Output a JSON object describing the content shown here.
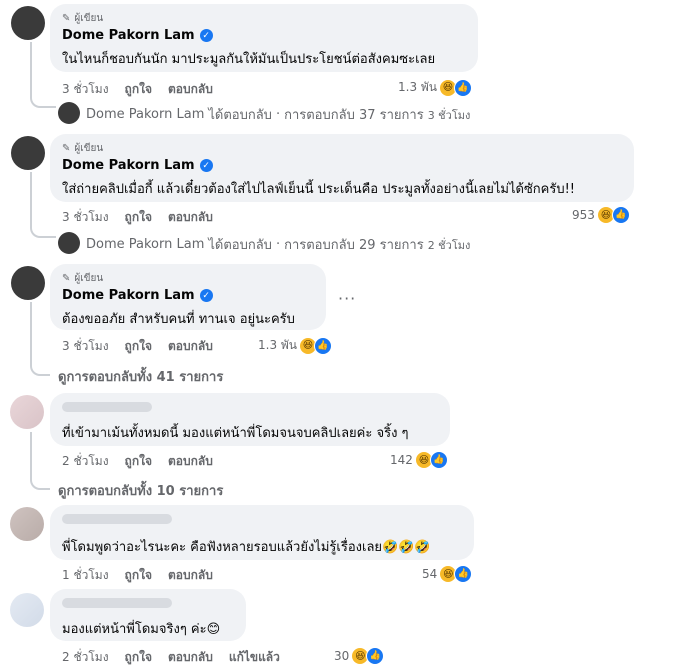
{
  "comments": [
    {
      "author_tag": "ผู้เขียน",
      "author": "Dome Pakorn Lam",
      "text": "ในไหนก็ชอบกันนัก มาประมูลกันให้มันเป็นประโยชน์ต่อสังคมซะเลย",
      "time": "3 ชั่วโมง",
      "like": "ถูกใจ",
      "reply": "ตอบกลับ",
      "reaction_count": "1.3 พัน",
      "reply_summary": {
        "name": "Dome Pakorn Lam",
        "verb": "ได้ตอบกลับ",
        "sep": "·",
        "count_text": "การตอบกลับ 37 รายการ",
        "time": "3 ชั่วโมง"
      }
    },
    {
      "author_tag": "ผู้เขียน",
      "author": "Dome Pakorn Lam",
      "text": "ใส่ถ่ายคลิปเมื่อกี้ แล้วเดี๋ยวต้องใส่ไปไลฟ์เย็นนี้ ประเด็นคือ ประมูลทั้งอย่างนี้เลยไม่ได้ซักครับ!!",
      "time": "3 ชั่วโมง",
      "like": "ถูกใจ",
      "reply": "ตอบกลับ",
      "reaction_count": "953",
      "reply_summary": {
        "name": "Dome Pakorn Lam",
        "verb": "ได้ตอบกลับ",
        "sep": "·",
        "count_text": "การตอบกลับ 29 รายการ",
        "time": "2 ชั่วโมง"
      }
    },
    {
      "author_tag": "ผู้เขียน",
      "author": "Dome Pakorn Lam",
      "text": "ต้องขออภัย สำหรับคนที่ ทานเจ อยู่นะครับ",
      "time": "3 ชั่วโมง",
      "like": "ถูกใจ",
      "reply": "ตอบกลับ",
      "reaction_count": "1.3 พัน",
      "more_dots": "···"
    }
  ],
  "view_all_replies_1": "ดูการตอบกลับทั้ง 41 รายการ",
  "replies": [
    {
      "text": "ที่เข้ามาเม้นทั้งหมดนี้ มองแต่หน้าพี่โดมจนจบคลิปเลยค่ะ จริ้ง ๆ",
      "time": "2 ชั่วโมง",
      "like": "ถูกใจ",
      "reply": "ตอบกลับ",
      "reaction_count": "142"
    },
    {
      "text": "พี่โดมพูดว่าอะไรนะคะ คือฟังหลายรอบแล้วยังไม่รู้เรื่องเลย🤣🤣🤣",
      "time": "1 ชั่วโมง",
      "like": "ถูกใจ",
      "reply": "ตอบกลับ",
      "reaction_count": "54"
    },
    {
      "text": "มองแต่หน้าพี่โดมจริงๆ ค่ะ😊",
      "time": "2 ชั่วโมง",
      "like": "ถูกใจ",
      "reply": "ตอบกลับ",
      "edited": "แก้ไขแล้ว",
      "reaction_count": "30"
    }
  ],
  "view_all_replies_2": "ดูการตอบกลับทั้ง 10 รายการ",
  "icons": {
    "author_tag": "pencil-icon",
    "verified": "verified-badge-icon",
    "haha": "haha-reaction-icon",
    "like": "like-reaction-icon",
    "reply_arrow": "reply-arrow-icon"
  },
  "colors": {
    "bubble": "#f0f2f5",
    "verified": "#1877f2",
    "meta": "#65676b"
  }
}
